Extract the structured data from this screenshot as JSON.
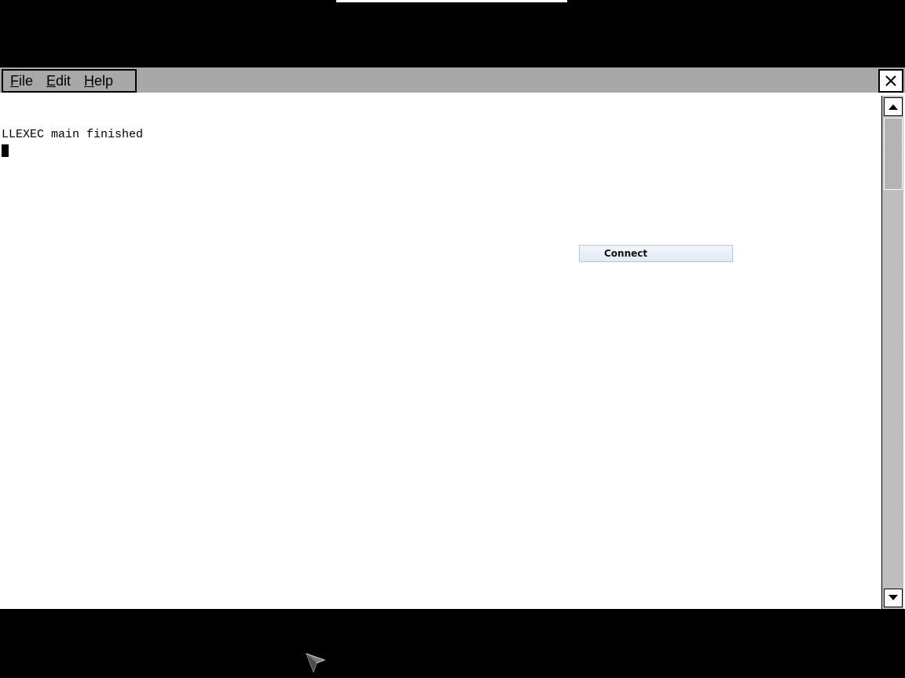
{
  "menubar": {
    "items": [
      {
        "accel": "F",
        "rest": "ile"
      },
      {
        "accel": "E",
        "rest": "dit"
      },
      {
        "accel": "H",
        "rest": "elp"
      }
    ]
  },
  "console": {
    "lines": [
      "LLEXEC main finished"
    ]
  },
  "connect_button": {
    "label": "Connect"
  },
  "icons": {
    "close": "close-icon",
    "scroll_up": "arrow-up-icon",
    "scroll_down": "arrow-down-icon",
    "pointer": "mouse-pointer-icon"
  }
}
